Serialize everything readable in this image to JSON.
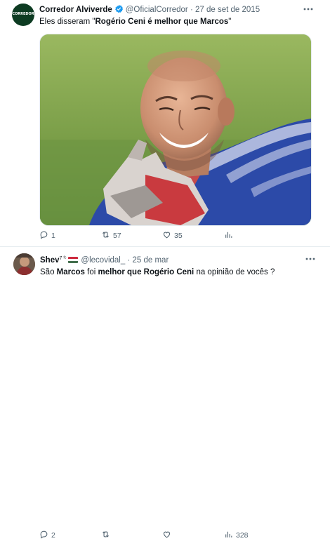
{
  "tweets": [
    {
      "author_name": "Corredor Alviverde",
      "handle": "@OficialCorredor",
      "separator": "·",
      "date": "27 de set de 2015",
      "avatar_text": "CORREDOR",
      "text_prefix": "Eles disseram \"",
      "text_bold": "Rogério Ceni é melhor que Marcos",
      "text_suffix": "\"",
      "media_description": "photo",
      "replies": "1",
      "retweets": "57",
      "likes": "35",
      "views": ""
    },
    {
      "author_name": "Shev",
      "author_sup": "7 ᶠᶜ",
      "handle": "@lecovidal_",
      "separator": "·",
      "date": "25 de mar",
      "text_1": "São ",
      "text_2": "Marcos",
      "text_3": " foi ",
      "text_4": "melhor que Rogério Ceni",
      "text_5": " na opinião de vocês ?",
      "replies": "2",
      "retweets": "",
      "likes": "",
      "views": "328"
    }
  ],
  "icons": [
    "verified-badge-icon",
    "more-icon",
    "reply-icon",
    "retweet-icon",
    "like-icon",
    "views-icon",
    "hungary-flag-icon"
  ],
  "colors": {
    "text": "#0f1419",
    "muted": "#536471",
    "verified": "#1d9bf0",
    "divider": "#e6ecf0",
    "avatar_bg": "#0d3b22"
  }
}
